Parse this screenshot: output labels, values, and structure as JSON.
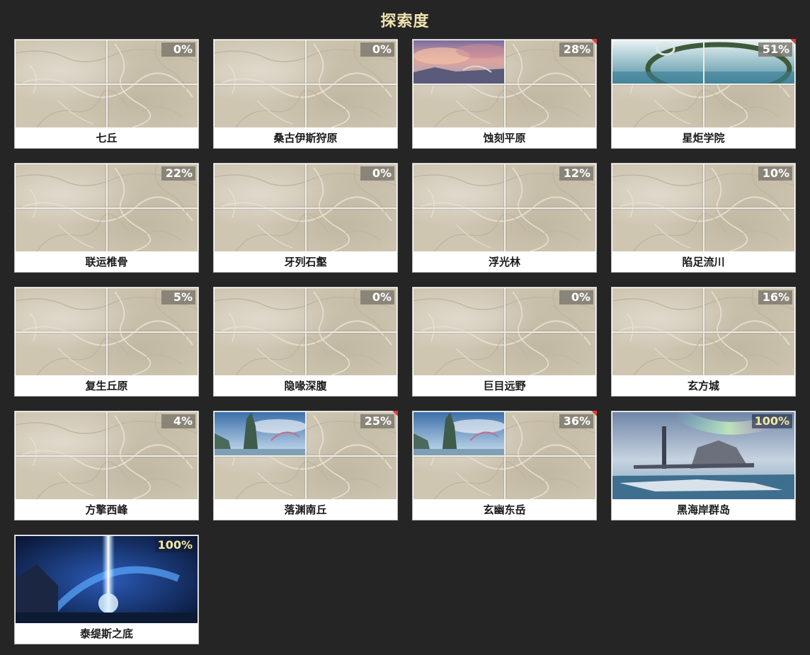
{
  "page": {
    "title": "探索度"
  },
  "cards": [
    {
      "name": "七丘",
      "percent": "0%",
      "image": "map"
    },
    {
      "name": "桑古伊斯狩原",
      "percent": "0%",
      "image": "map"
    },
    {
      "name": "蚀刻平原",
      "percent": "28%",
      "image": "map-sunset-quadrant",
      "flag": true
    },
    {
      "name": "星炬学院",
      "percent": "51%",
      "image": "map-ring-sky-half",
      "flag": true
    },
    {
      "name": "联运椎骨",
      "percent": "22%",
      "image": "map"
    },
    {
      "name": "牙列石壑",
      "percent": "0%",
      "image": "map"
    },
    {
      "name": "浮光林",
      "percent": "12%",
      "image": "map"
    },
    {
      "name": "陷足流川",
      "percent": "10%",
      "image": "map"
    },
    {
      "name": "复生丘原",
      "percent": "5%",
      "image": "map"
    },
    {
      "name": "隐喙深腹",
      "percent": "0%",
      "image": "map"
    },
    {
      "name": "巨目远野",
      "percent": "0%",
      "image": "map"
    },
    {
      "name": "玄方城",
      "percent": "16%",
      "image": "map"
    },
    {
      "name": "方擎西峰",
      "percent": "4%",
      "image": "map"
    },
    {
      "name": "落渊南丘",
      "percent": "25%",
      "image": "map-spire-quadrant",
      "flag": true
    },
    {
      "name": "玄幽东岳",
      "percent": "36%",
      "image": "map-spire-quadrant",
      "flag": true
    },
    {
      "name": "黑海岸群岛",
      "percent": "100%",
      "image": "island-aurora"
    },
    {
      "name": "泰缇斯之底",
      "percent": "100%",
      "image": "blue-beam-arch"
    }
  ],
  "colors": {
    "background": "#252525",
    "title": "#efe3b0",
    "flag": "#d8413b",
    "map_paper": "#cfc6b2"
  }
}
